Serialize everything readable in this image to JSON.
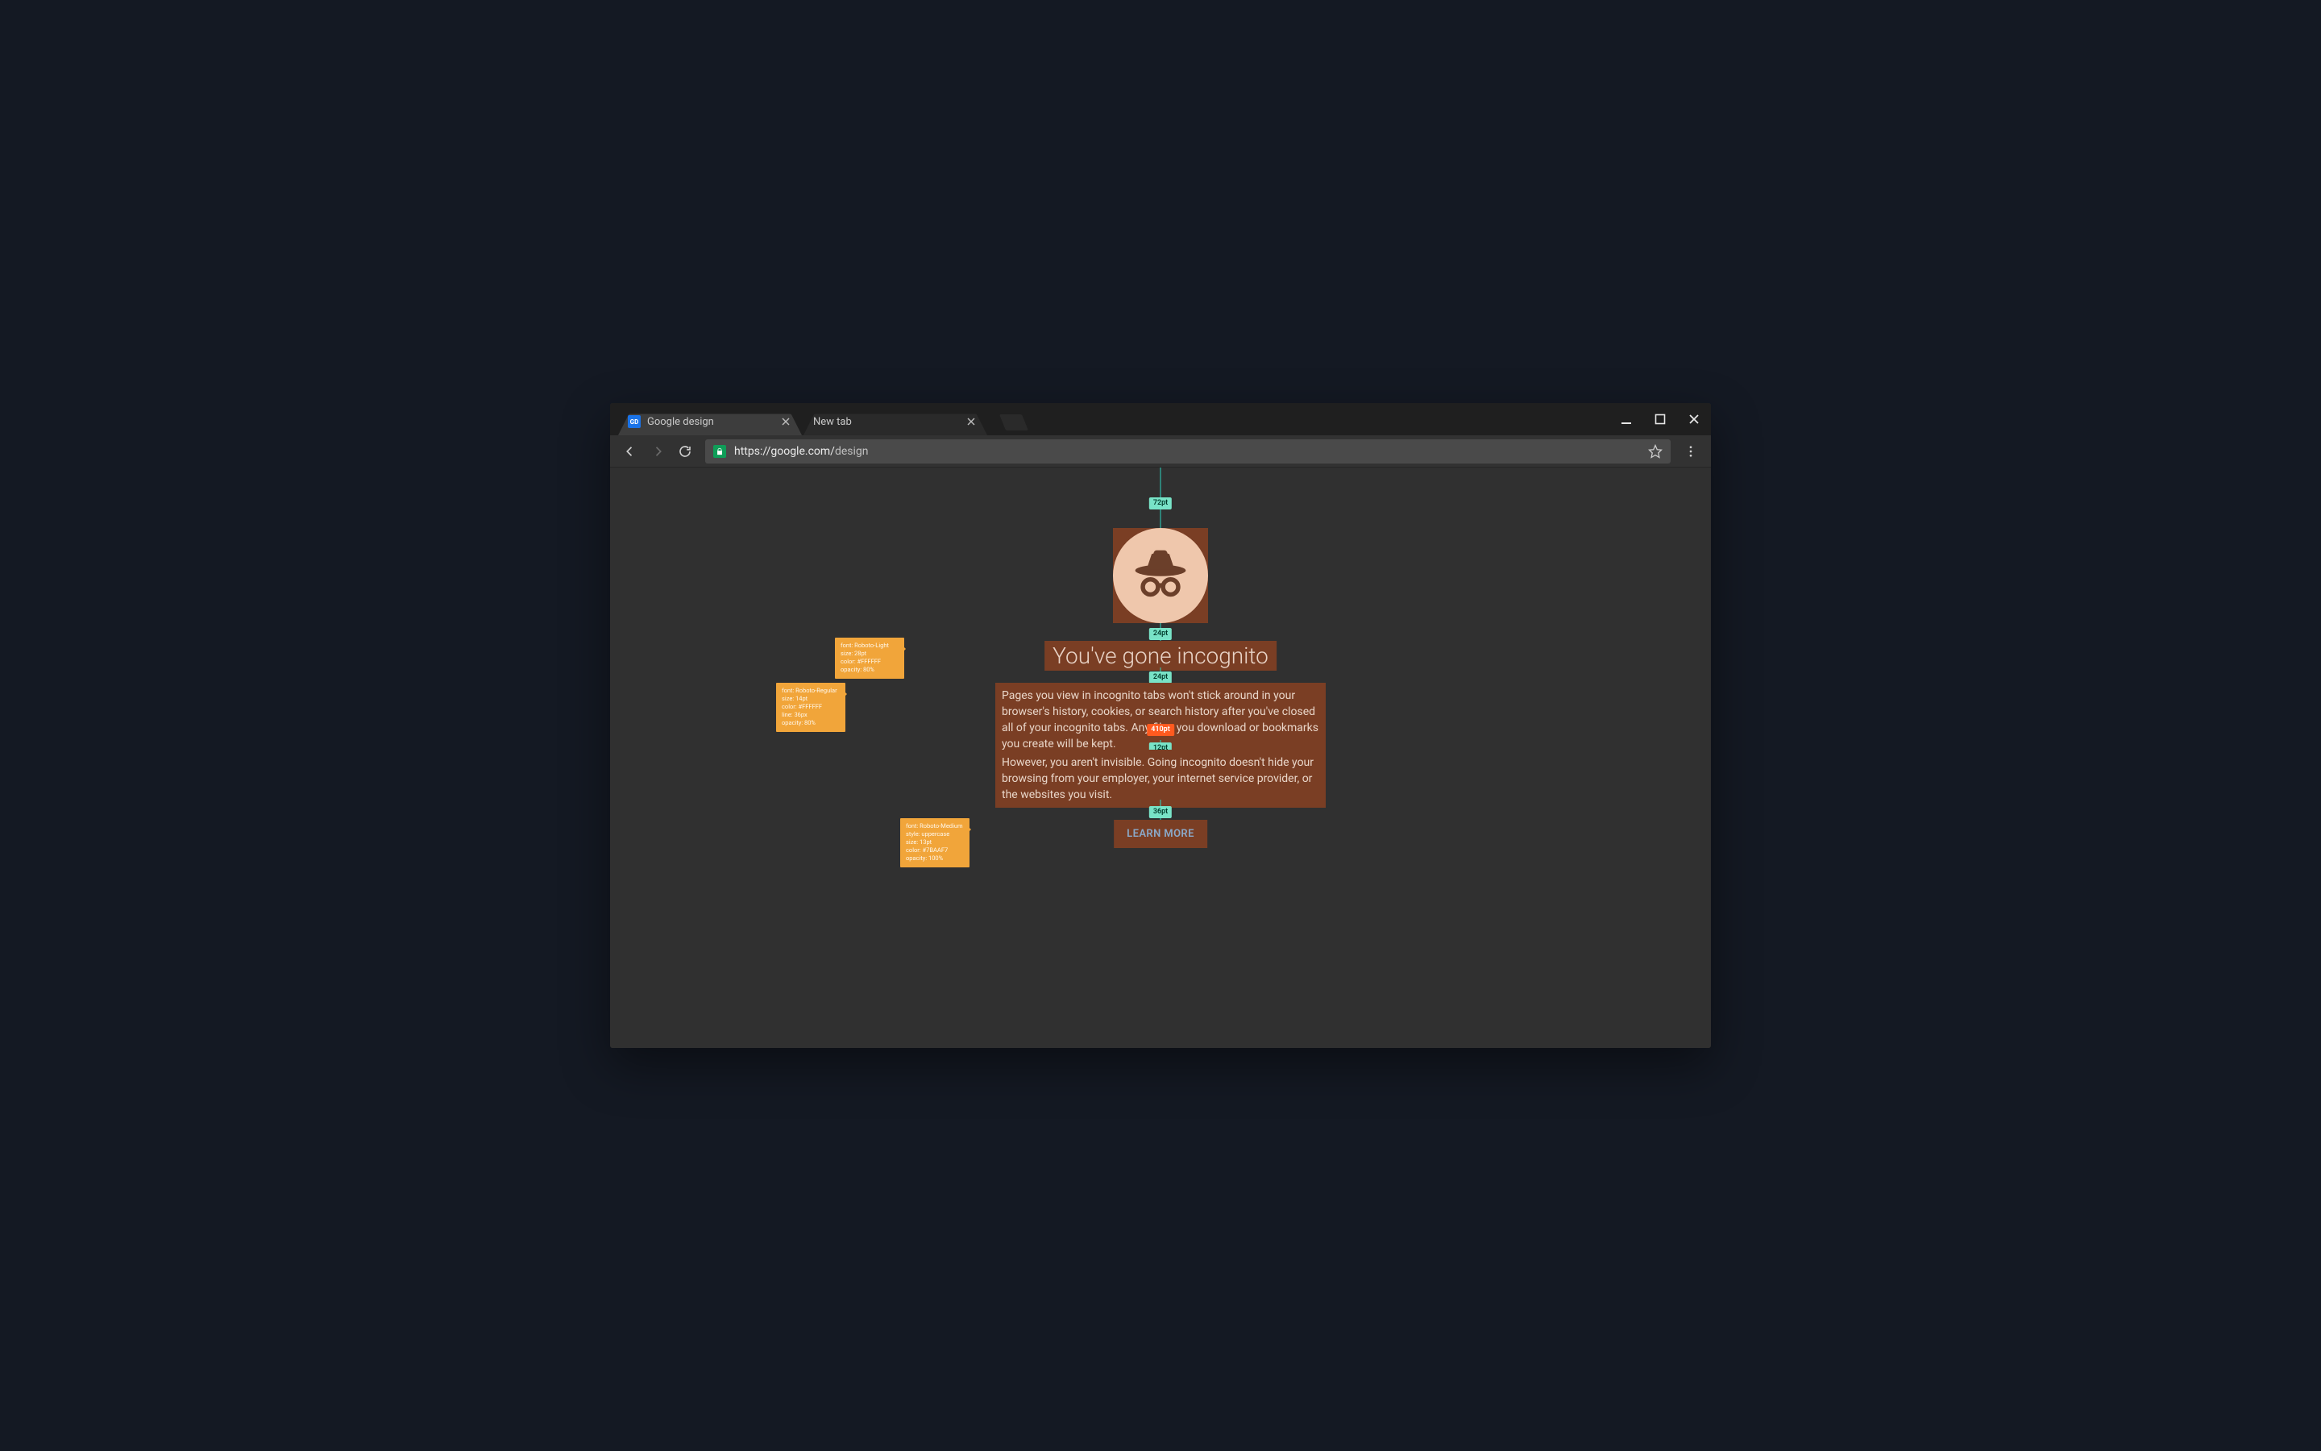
{
  "tabs": [
    {
      "label": "Google design",
      "favicon": "GD",
      "active": true
    },
    {
      "label": "New tab",
      "favicon": "",
      "active": false
    }
  ],
  "omnibox": {
    "origin": "https://google.com/",
    "path": "design"
  },
  "page": {
    "title": "You've gone incognito",
    "para1": "Pages you view in incognito tabs won't stick around in your browser's history, cookies, or search history after you've closed all of your incognito tabs. Any files you download or bookmarks you create will be kept.",
    "para2": "However, you aren't invisible. Going incognito doesn't hide your browsing from your employer, your internet service provider, or the websites you visit.",
    "button": "LEARN MORE"
  },
  "measurements": {
    "m1": "72pt",
    "m2": "24pt",
    "m3": "24pt",
    "m4": "12pt",
    "m5": "36pt",
    "width": "410pt"
  },
  "specs": {
    "title": {
      "font": "font: Roboto-Light",
      "size": "size: 28pt",
      "color": "color: #FFFFFF",
      "opacity": "opacity: 80%"
    },
    "body": {
      "font": "font: Roboto-Regular",
      "size": "size: 14pt",
      "color": "color: #FFFFFF",
      "line": "line: 36px",
      "opacity": "opacity: 80%"
    },
    "button": {
      "font": "font: Roboto-Medium",
      "style": "style: uppercase",
      "size": "size: 13pt",
      "color": "color: #7BAAF7",
      "opacity": "opacity: 100%"
    }
  }
}
